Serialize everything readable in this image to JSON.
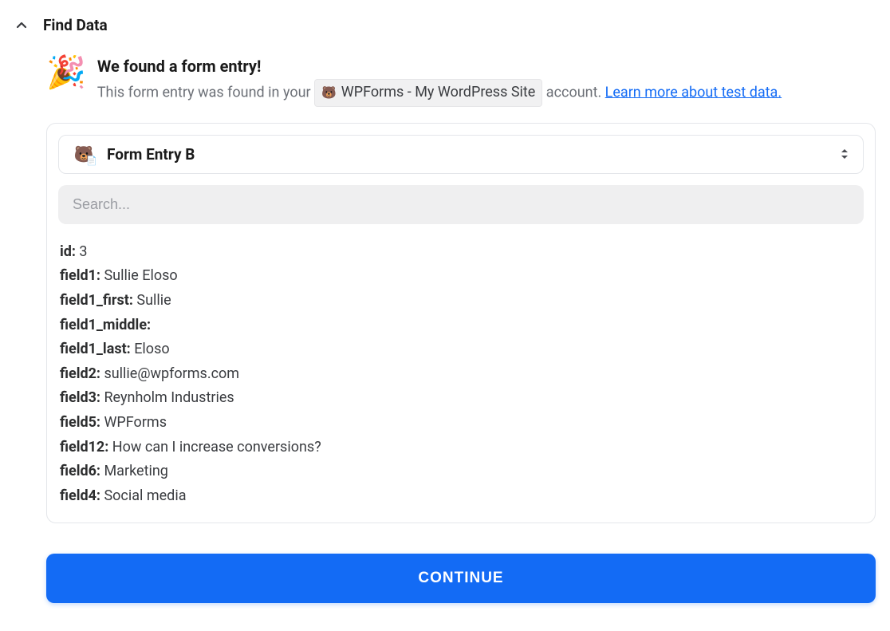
{
  "section_title": "Find Data",
  "found": {
    "heading": "We found a form entry!",
    "sub_prefix": "This form entry was found in your ",
    "account_label": "WPForms - My WordPress Site",
    "sub_suffix": " account. ",
    "learn_link": "Learn more about test data."
  },
  "entry_select": {
    "label": "Form Entry B"
  },
  "search": {
    "placeholder": "Search..."
  },
  "fields": [
    {
      "key": "id",
      "value": "3"
    },
    {
      "key": "field1",
      "value": "Sullie Eloso"
    },
    {
      "key": "field1_first",
      "value": "Sullie"
    },
    {
      "key": "field1_middle",
      "value": ""
    },
    {
      "key": "field1_last",
      "value": "Eloso"
    },
    {
      "key": "field2",
      "value": "sullie@wpforms.com"
    },
    {
      "key": "field3",
      "value": "Reynholm Industries"
    },
    {
      "key": "field5",
      "value": "WPForms"
    },
    {
      "key": "field12",
      "value": "How can I increase conversions?"
    },
    {
      "key": "field6",
      "value": "Marketing"
    },
    {
      "key": "field4",
      "value": "Social media"
    }
  ],
  "continue_label": "CONTINUE"
}
